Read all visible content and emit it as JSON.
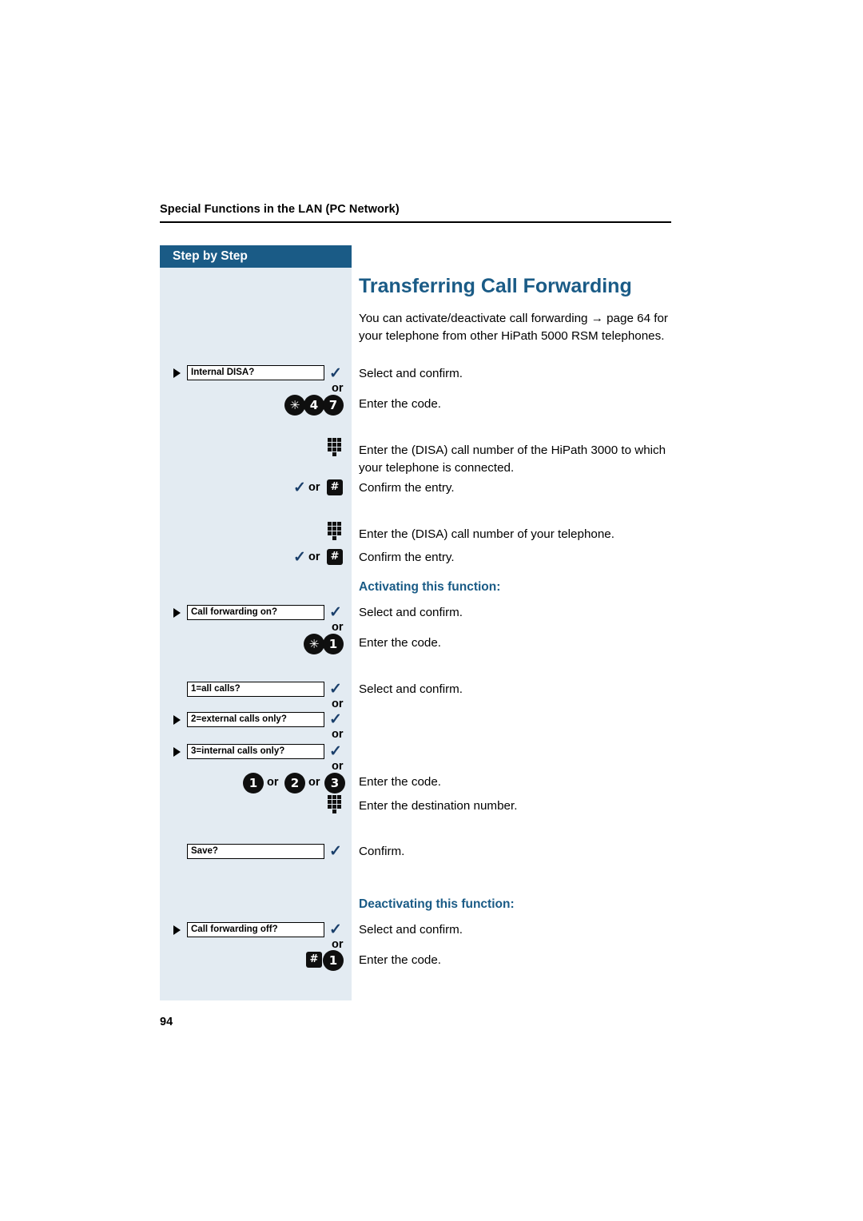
{
  "header": {
    "section_title": "Special Functions in the LAN (PC Network)",
    "step_by_step": "Step by Step"
  },
  "main": {
    "title": "Transferring Call Forwarding",
    "intro": "You can activate/deactivate call forwarding → page 64 for your telephone from other HiPath 5000 RSM telephones.",
    "subhead_activate": "Activating this function:",
    "subhead_deactivate": "Deactivating this function:"
  },
  "steps": [
    {
      "option_label": "Internal DISA?",
      "check": "✓",
      "or": "or",
      "keys": [
        "✳",
        "4",
        "7"
      ],
      "desc_confirm": "Select and confirm.",
      "desc_code": "Enter the code."
    },
    {
      "desc": "Enter the (DISA) call number of the HiPath 3000 to which your telephone is connected.",
      "confirm_entry": "Confirm the entry.",
      "or": "or"
    },
    {
      "desc": "Enter the (DISA) call number of your telephone.",
      "confirm_entry": "Confirm the entry.",
      "or": "or"
    },
    {
      "option_label": "Call forwarding on?",
      "check": "✓",
      "or": "or",
      "keys": [
        "✳",
        "1"
      ],
      "desc_confirm": "Select and confirm.",
      "desc_code": "Enter the code."
    },
    {
      "option_label": "1=all calls?",
      "check": "✓",
      "or": "or"
    },
    {
      "option_label": "2=external calls only?",
      "check": "✓",
      "or": "or"
    },
    {
      "option_label": "3=internal calls only?",
      "check": "✓",
      "or": "or",
      "desc_confirm": "Select and confirm."
    },
    {
      "keys": [
        "1",
        "2",
        "3"
      ],
      "or_1": "or",
      "or_2": "or",
      "desc_code": "Enter the code.",
      "desc_dest": "Enter the destination number."
    },
    {
      "option_label": "Save?",
      "check": "✓",
      "desc_confirm": "Confirm."
    },
    {
      "option_label": "Call forwarding off?",
      "check": "✓",
      "or": "or",
      "keys": [
        "#",
        "1"
      ],
      "desc_confirm": "Select and confirm.",
      "desc_code": "Enter the code."
    }
  ],
  "labels": {
    "hash_key": "#",
    "star_key": "✳"
  },
  "footer": {
    "page_number": "94"
  },
  "colors": {
    "accent": "#1a5b86",
    "panel": "#e3ebf2"
  }
}
